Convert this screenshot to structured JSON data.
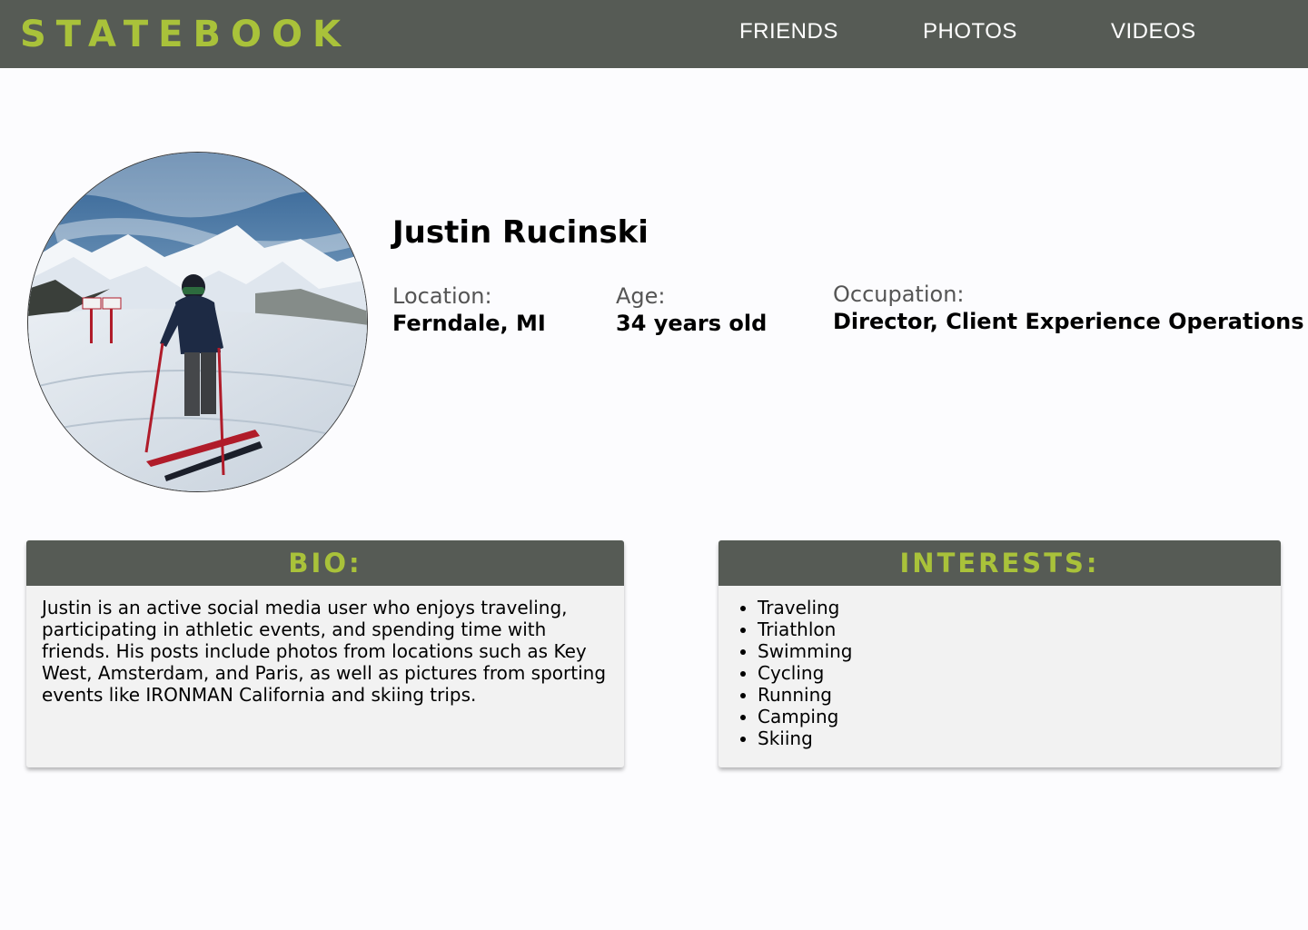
{
  "header": {
    "logo": "STATEBOOK",
    "nav": [
      {
        "label": "FRIENDS"
      },
      {
        "label": "PHOTOS"
      },
      {
        "label": "VIDEOS"
      }
    ]
  },
  "profile": {
    "photo_icon": "skier-photo",
    "name": "Justin Rucinski",
    "location_label": "Location:",
    "location_value": "Ferndale, MI",
    "age_label": "Age:",
    "age_value": "34 years old",
    "occupation_label": "Occupation:",
    "occupation_value": "Director, Client Experience Operations"
  },
  "bio": {
    "title": "BIO:",
    "text": "Justin is an active social media user who enjoys traveling, participating in athletic events, and spending time with friends. His posts include photos from locations such as Key West, Amsterdam, and Paris, as well as pictures from sporting events like IRONMAN California and skiing trips."
  },
  "interests": {
    "title": "INTERESTS:",
    "items": [
      "Traveling",
      "Triathlon",
      "Swimming",
      "Cycling",
      "Running",
      "Camping",
      "Skiing"
    ]
  },
  "colors": {
    "header_bg": "#565b55",
    "accent": "#a9c23a",
    "card_bg": "#f2f2f2"
  }
}
